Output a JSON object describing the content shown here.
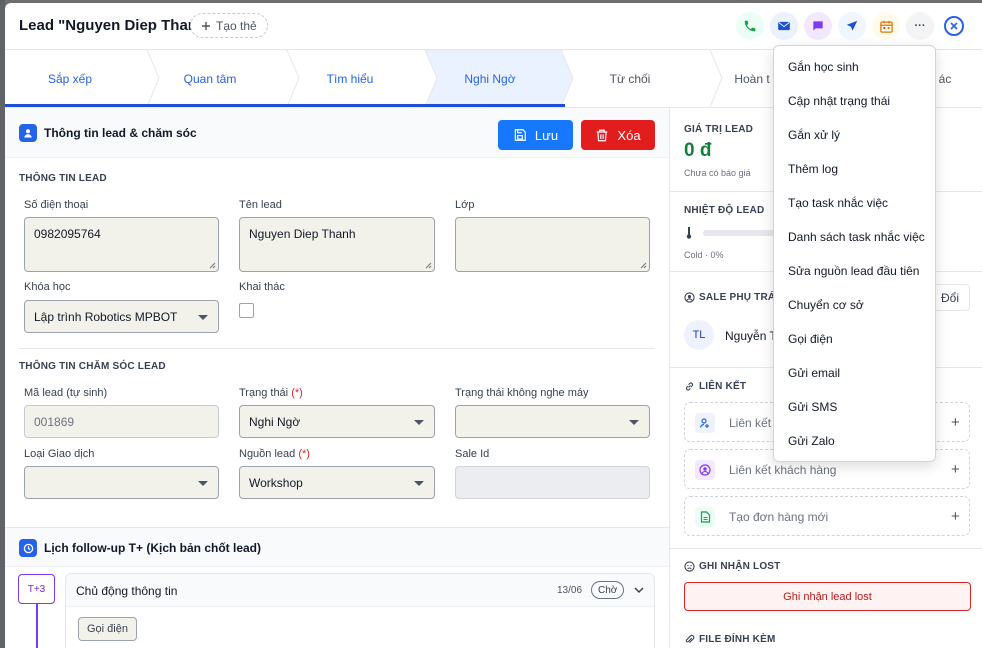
{
  "header": {
    "title": "Lead \"Nguyen Diep Thanh\"",
    "tag_button": "Tạo thẻ",
    "icons": [
      "phone-icon",
      "mail-icon",
      "chat-icon",
      "send-icon",
      "calendar-icon",
      "more-icon",
      "close-icon"
    ],
    "more_label": "···"
  },
  "stages": [
    {
      "label": "Sắp xếp"
    },
    {
      "label": "Quan tâm"
    },
    {
      "label": "Tìm hiểu"
    },
    {
      "label": "Nghi Ngờ"
    },
    {
      "label": "Từ chối"
    },
    {
      "label": "Hoàn t"
    },
    {
      "label": "ác"
    }
  ],
  "form": {
    "section_title": "Thông tin lead & chăm sóc",
    "save_label": "Lưu",
    "delete_label": "Xóa",
    "lead_info_title": "THÔNG TIN LEAD",
    "phone_label": "Số điện thoại",
    "phone_value": "0982095764",
    "name_label": "Tên lead",
    "name_value": "Nguyen Diep Thanh",
    "class_label": "Lớp",
    "course_label": "Khóa học",
    "course_value": "Lập trình Robotics MPBOT",
    "exploit_label": "Khai thác",
    "care_info_title": "THÔNG TIN CHĂM SÓC LEAD",
    "lead_code_label": "Mã lead (tự sinh)",
    "lead_code_value": "001869",
    "status_label": "Trạng thái",
    "required_mark": "(*)",
    "status_value": "Nghi Ngờ",
    "no_answer_label": "Trạng thái không nghe máy",
    "transaction_label": "Loại Giao dịch",
    "source_label": "Nguồn lead",
    "source_value": "Workshop",
    "sale_id_label": "Sale Id"
  },
  "followup": {
    "title": "Lịch follow-up T+ (Kịch bản chốt lead)",
    "badge": "T+3",
    "card_title": "Chủ động thông tin",
    "card_date": "13/06",
    "card_status": "Chờ",
    "action": "Gọi điện"
  },
  "right": {
    "value_label": "GIÁ TRỊ LEAD",
    "value": "0 đ",
    "value_sub": "Chưa có báo giá",
    "heat_label": "NHIỆT ĐỘ LEAD",
    "heat_sub": "Cold · 0%",
    "heat_percent": 0,
    "sale_label": "SALE PHỤ TRÁC",
    "change_label": "Đổi",
    "sale_initials": "TL",
    "sale_name": "Nguyễn T",
    "links_label": "LIÊN KẾT",
    "links": [
      {
        "label": "Liên kết",
        "icon": "user-link-icon",
        "color": "#eef2ff"
      },
      {
        "label": "Liên kết khách hàng",
        "icon": "customer-icon",
        "color": "#f3e8ff"
      },
      {
        "label": "Tạo đơn hàng mới",
        "icon": "document-icon",
        "color": "#ecfdf5"
      }
    ],
    "plus": "+",
    "lost_label": "GHI NHẬN LOST",
    "lost_button": "Ghi nhận lead lost",
    "file_label": "FILE ĐÍNH KÈM"
  },
  "menu": {
    "items": [
      "Gắn học sinh",
      "Cập nhật trạng thái",
      "Gắn xử lý",
      "Thêm log",
      "Tạo task nhắc việc",
      "Danh sách task nhắc việc",
      "Sửa nguồn lead đầu tiên",
      "Chuyển cơ sở",
      "Gọi điện",
      "Gửi email",
      "Gửi SMS",
      "Gửi Zalo"
    ]
  },
  "colors": {
    "accent": "#2563eb",
    "save": "#1677ff",
    "danger": "#e11d1d",
    "value_green": "#15803d",
    "followup_purple": "#7c3aed"
  }
}
